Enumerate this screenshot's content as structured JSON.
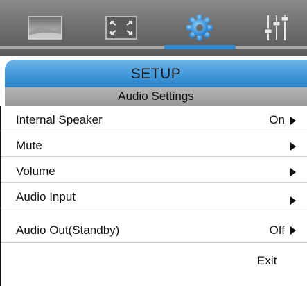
{
  "tabs": [
    {
      "icon": "picture-icon",
      "active": false
    },
    {
      "icon": "screen-fit-icon",
      "active": false
    },
    {
      "icon": "gear-icon",
      "active": true
    },
    {
      "icon": "audio-sliders-icon",
      "active": false
    }
  ],
  "header": {
    "title": "SETUP"
  },
  "section": {
    "title": "Audio Settings"
  },
  "menu": {
    "items": [
      {
        "label": "Internal Speaker",
        "value": "On"
      },
      {
        "label": "Mute",
        "value": ""
      },
      {
        "label": "Volume",
        "value": ""
      },
      {
        "label": "Audio Input",
        "value": ""
      },
      {
        "label": "Audio Out(Standby)",
        "value": "Off"
      }
    ],
    "exit_label": "Exit"
  },
  "colors": {
    "accent": "#2f89d0",
    "tabbar": "#6c6c6c",
    "subtitle_bar": "#a6a6a6"
  }
}
